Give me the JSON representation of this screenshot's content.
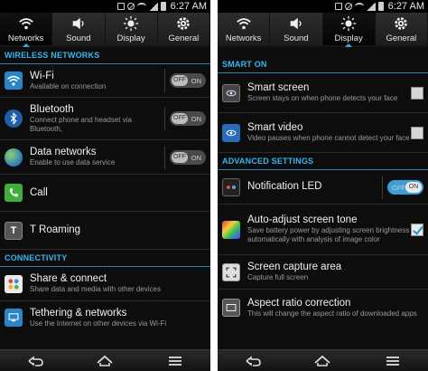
{
  "status_bar": {
    "time": "6:27 AM"
  },
  "tabs": [
    {
      "label": "Networks",
      "icon": "wifi-icon"
    },
    {
      "label": "Sound",
      "icon": "speaker-icon"
    },
    {
      "label": "Display",
      "icon": "brightness-icon"
    },
    {
      "label": "General",
      "icon": "gear-icon"
    }
  ],
  "left": {
    "active_tab": "Networks",
    "section_wireless": "WIRELESS NETWORKS",
    "wifi": {
      "title": "Wi-Fi",
      "sub": "Available on connection",
      "toggle_off": "OFF",
      "toggle_on": "ON",
      "state": "off"
    },
    "bluetooth": {
      "title": "Bluetooth",
      "sub": "Connect phone and headset via Bluetooth,",
      "toggle_off": "OFF",
      "toggle_on": "ON",
      "state": "off"
    },
    "data": {
      "title": "Data networks",
      "sub": "Enable to use data service",
      "toggle_off": "OFF",
      "toggle_on": "ON",
      "state": "off"
    },
    "call": {
      "title": "Call"
    },
    "roaming": {
      "title": "T Roaming"
    },
    "section_connectivity": "CONNECTIVITY",
    "share": {
      "title": "Share & connect",
      "sub": "Share data and media with other devices"
    },
    "tethering": {
      "title": "Tethering & networks",
      "sub": "Use the Internet on other devices via Wi-Fi"
    }
  },
  "right": {
    "active_tab": "Display",
    "section_smart": "SMART ON",
    "smart_screen": {
      "title": "Smart screen",
      "sub": "Screen stays on when phone detects your face",
      "checked": false
    },
    "smart_video": {
      "title": "Smart video",
      "sub": "Video pauses when phone cannot detect your face",
      "checked": false
    },
    "section_advanced": "ADVANCED SETTINGS",
    "notification_led": {
      "title": "Notification LED",
      "toggle_off": "OFF",
      "toggle_on": "ON",
      "state": "on"
    },
    "auto_adjust": {
      "title": "Auto-adjust screen tone",
      "sub": "Save battery power by adjusting screen brightness automatically with analysis of image color",
      "checked": true
    },
    "screen_capture": {
      "title": "Screen capture area",
      "sub": "Capture full screen"
    },
    "aspect_ratio": {
      "title": "Aspect ratio correction",
      "sub": "This will change the aspect ratio of downloaded apps"
    }
  },
  "colors": {
    "accent": "#39b6ef",
    "background": "#0d0d0d",
    "toggle_on": "#3c9fd6"
  }
}
